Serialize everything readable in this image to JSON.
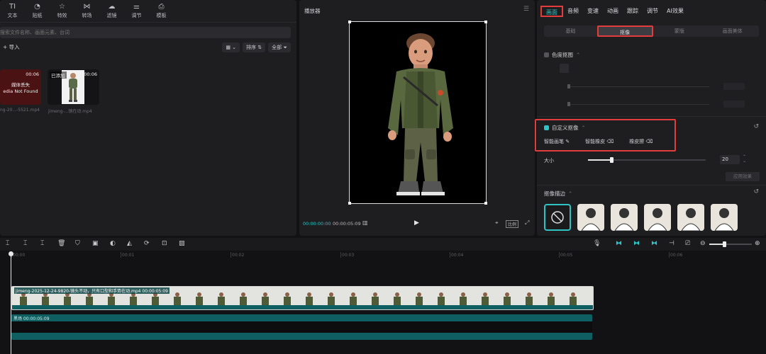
{
  "toolbar": {
    "items": [
      {
        "label": "文本",
        "icon": "TI"
      },
      {
        "label": "贴纸",
        "icon": "◔"
      },
      {
        "label": "特效",
        "icon": "☆"
      },
      {
        "label": "转场",
        "icon": "⋈"
      },
      {
        "label": "滤镜",
        "icon": "☁"
      },
      {
        "label": "调节",
        "icon": "⚌"
      },
      {
        "label": "模板",
        "icon": "⎙"
      }
    ]
  },
  "media": {
    "search_placeholder": "搜索文件名称、画面元素、台词",
    "import_label": "导入",
    "sort_label": "排序",
    "all_label": "全部",
    "items": [
      {
        "duration": "00:06",
        "missing_line1": "媒体丢失",
        "missing_line2": "edia Not Found",
        "filename": "ng-20...-5521.mp4"
      },
      {
        "duration": "00:06",
        "tag": "已添加",
        "filename": "jimeng-...镜在动.mp4"
      }
    ]
  },
  "player": {
    "title": "播放器",
    "current_time": "00:00:00:00",
    "total_time": "00:00:05:09",
    "ratio_label": "比例"
  },
  "props": {
    "tabs": [
      "画面",
      "音频",
      "变速",
      "动画",
      "跟踪",
      "调节",
      "AI效果"
    ],
    "active_tab": 0,
    "subtabs": [
      "基础",
      "抠像",
      "蒙版",
      "画面美体"
    ],
    "active_subtab": 1,
    "chroma_title": "色度抠图",
    "custom_cutout_title": "自定义抠像",
    "tools": [
      "智能画笔",
      "智能橡皮",
      "橡皮擦"
    ],
    "size_label": "大小",
    "size_value": "20",
    "size_fraction": 0.2,
    "apply_label": "应用效果",
    "stroke_title": "抠像描边"
  },
  "timeline": {
    "ruler": [
      "00:00",
      "00:01",
      "00:02",
      "00:03",
      "00:04",
      "00:05",
      "00:06"
    ],
    "video_clip_label": "jimeng-2025-12-24-9820-镜头不动，只有口型和手势在动.mp4  00:00:05:09",
    "bg_clip_label": "黑场  00:00:05:09"
  },
  "colors": {
    "accent": "#2ec4c4",
    "highlight": "#e23d3d"
  }
}
